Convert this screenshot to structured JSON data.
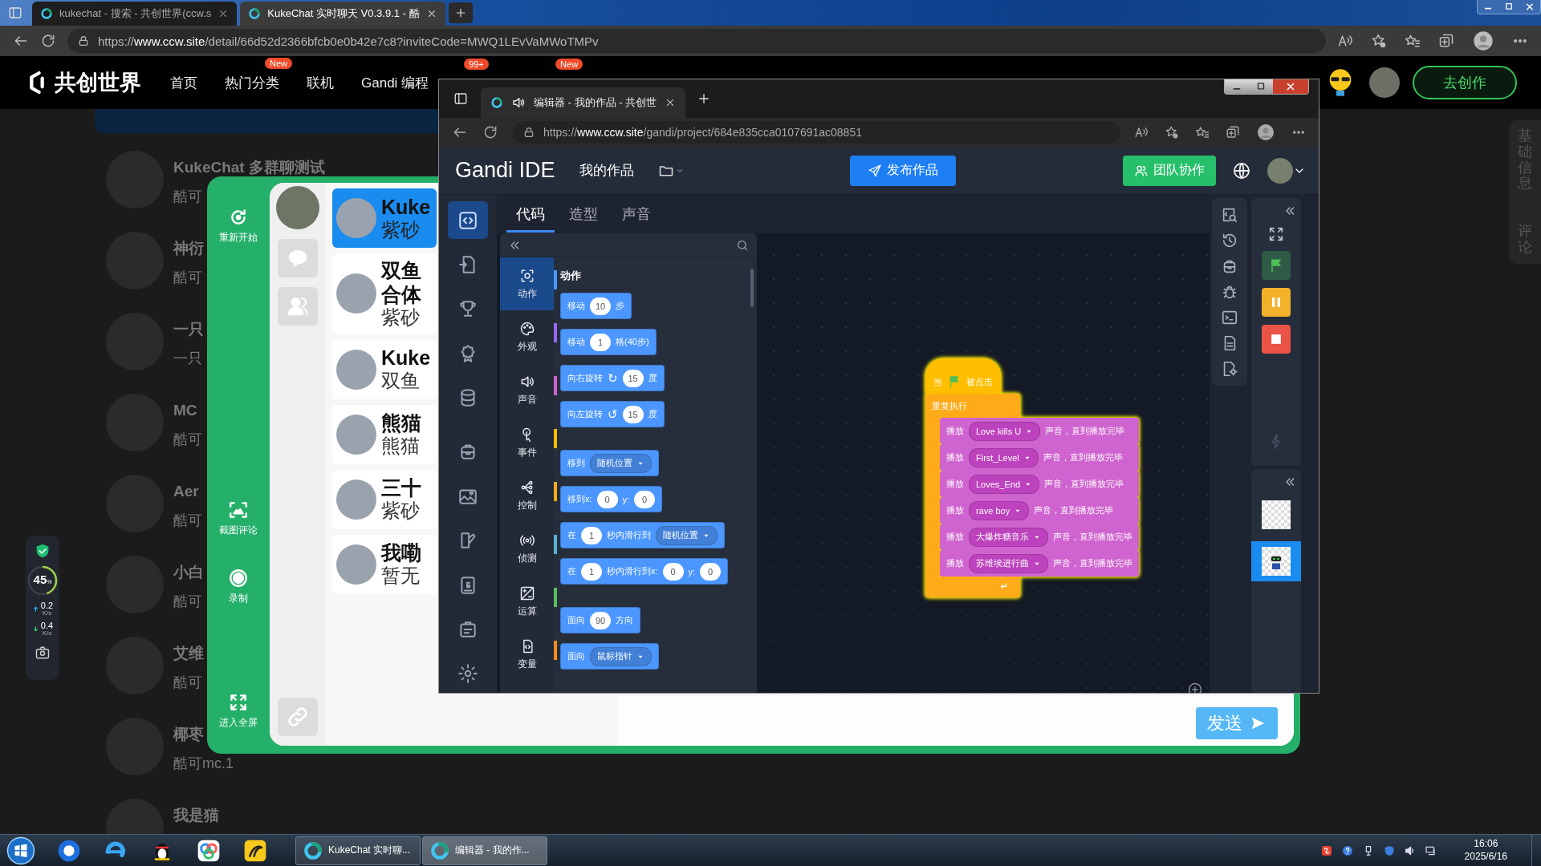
{
  "browser": {
    "tabs": [
      {
        "title": "kukechat - 搜索 - 共创世界(ccw.s",
        "selected": false
      },
      {
        "title": "KukeChat 实时聊天 V0.3.9.1 - 酷",
        "selected": true
      }
    ],
    "url": "https://**www.ccw.site**/detail/66d52d2366bfcb0e0b42e7c8?inviteCode=MWQ1LEvVaMWoTMPv"
  },
  "site": {
    "logo": "共创世界",
    "nav": [
      {
        "label": "首页"
      },
      {
        "label": "热门分类",
        "badge": "New"
      },
      {
        "label": "联机"
      },
      {
        "label": "Gandi 编程"
      },
      {
        "badge": "99+"
      },
      {
        "badge": "New"
      }
    ],
    "create": "去创作",
    "side_tabs": [
      {
        "label": "基础信息"
      },
      {
        "label": "评论"
      }
    ],
    "list": [
      {
        "name": "KukeChat 多群聊测试",
        "preview": "酷可"
      },
      {
        "name": "神衍",
        "preview": "酷可"
      },
      {
        "name": "一只",
        "preview": "一只"
      },
      {
        "name": "MC",
        "preview": "酷可"
      },
      {
        "name": "Aer",
        "preview": "酷可"
      },
      {
        "name": "小白",
        "preview": "酷可"
      },
      {
        "name": "艾维",
        "preview": "酷可"
      },
      {
        "name": "椰枣",
        "preview": "酷可mc.1"
      },
      {
        "name": "我是猫"
      }
    ]
  },
  "net": {
    "percent": "45",
    "percent_unit": "%",
    "level": 0.45,
    "up": {
      "value": "0.2",
      "unit": "K/s"
    },
    "down": {
      "value": "0.4",
      "unit": "K/s"
    }
  },
  "chat": {
    "actions": [
      {
        "kind": "restart",
        "label": "重新开始"
      },
      {
        "kind": "screenshot",
        "label": "截图评论"
      },
      {
        "kind": "record",
        "label": "录制"
      },
      {
        "kind": "fullscreen",
        "label": "进入全屏"
      }
    ],
    "conversations": [
      {
        "name": [
          "Kuke"
        ],
        "preview": "紫砂",
        "selected": true
      },
      {
        "name": [
          "双鱼",
          "合体"
        ],
        "preview": "紫砂",
        "selected": false
      },
      {
        "name": [
          "Kuke"
        ],
        "preview": "双鱼",
        "selected": false
      },
      {
        "name": [
          "熊猫"
        ],
        "preview": "熊猫",
        "selected": false
      },
      {
        "name": [
          "三十"
        ],
        "preview": "紫砂",
        "selected": false
      },
      {
        "name": [
          "我嘞"
        ],
        "preview": "暂无",
        "selected": false
      }
    ],
    "send": "发送"
  },
  "editor": {
    "tab_title": "编辑器 - 我的作品 - 共创世",
    "url": "https://**www.ccw.site**/gandi/project/684e835cca0107691ac08851",
    "brand": "**Gandi** IDE",
    "project": "我的作品",
    "publish": "发布作品",
    "team": "团队协作",
    "rail": [
      {
        "kind": "code",
        "selected": true
      },
      {
        "kind": "import",
        "selected": false
      },
      {
        "kind": "trophy",
        "selected": false
      },
      {
        "kind": "badge",
        "selected": false
      },
      {
        "kind": "database",
        "selected": false
      },
      {
        "kind": "backpack",
        "selected": false
      },
      {
        "kind": "image",
        "selected": false
      },
      {
        "kind": "book",
        "selected": false
      },
      {
        "kind": "guide",
        "selected": false
      },
      {
        "kind": "clipboard",
        "selected": false
      },
      {
        "kind": "gear",
        "selected": false
      }
    ],
    "tabs": [
      {
        "label": "代码",
        "selected": true
      },
      {
        "label": "造型",
        "selected": false
      },
      {
        "label": "声音",
        "selected": false
      }
    ],
    "categories": [
      {
        "label": "动作",
        "kind": "motion",
        "color": "#4c97ff",
        "selected": true
      },
      {
        "label": "外观",
        "kind": "looks",
        "color": "#9966ff",
        "selected": false
      },
      {
        "label": "声音",
        "kind": "sound",
        "color": "#cf63cf",
        "selected": false
      },
      {
        "label": "事件",
        "kind": "events",
        "color": "#ffbf00",
        "selected": false
      },
      {
        "label": "控制",
        "kind": "control",
        "color": "#ffab19",
        "selected": false
      },
      {
        "label": "侦测",
        "kind": "sensing",
        "color": "#5cb1d6",
        "selected": false
      },
      {
        "label": "运算",
        "kind": "operators",
        "color": "#59c059",
        "selected": false
      },
      {
        "label": "变量",
        "kind": "variables",
        "color": "#ff8c1a",
        "selected": false
      }
    ],
    "palette_title": "动作",
    "blocks": [
      {
        "parts": [
          {
            "kind": "label",
            "text": "移动"
          },
          {
            "kind": "number",
            "text": "10"
          },
          {
            "kind": "label",
            "text": "步"
          }
        ]
      },
      {
        "parts": [
          {
            "kind": "label",
            "text": "移动"
          },
          {
            "kind": "number",
            "text": "1"
          },
          {
            "kind": "label",
            "text": "格(40步)"
          }
        ]
      },
      {
        "parts": [
          {
            "kind": "label",
            "text": "向右旋转"
          },
          {
            "kind": "glyph",
            "text": "↻"
          },
          {
            "kind": "number",
            "text": "15"
          },
          {
            "kind": "label",
            "text": "度"
          }
        ]
      },
      {
        "parts": [
          {
            "kind": "label",
            "text": "向左旋转"
          },
          {
            "kind": "glyph",
            "text": "↺"
          },
          {
            "kind": "number",
            "text": "15"
          },
          {
            "kind": "label",
            "text": "度"
          }
        ]
      },
      {
        "group_start": true,
        "parts": [
          {
            "kind": "label",
            "text": "移到"
          },
          {
            "kind": "menu",
            "text": "随机位置"
          }
        ]
      },
      {
        "parts": [
          {
            "kind": "label",
            "text": "移到x:"
          },
          {
            "kind": "number",
            "text": "0"
          },
          {
            "kind": "label",
            "text": "y:"
          },
          {
            "kind": "number",
            "text": "0"
          }
        ]
      },
      {
        "parts": [
          {
            "kind": "label",
            "text": "在"
          },
          {
            "kind": "number",
            "text": "1"
          },
          {
            "kind": "label",
            "text": "秒内滑行到"
          },
          {
            "kind": "menu",
            "text": "随机位置"
          }
        ]
      },
      {
        "parts": [
          {
            "kind": "label",
            "text": "在"
          },
          {
            "kind": "number",
            "text": "1"
          },
          {
            "kind": "label",
            "text": "秒内滑行到x:"
          },
          {
            "kind": "number",
            "text": "0"
          },
          {
            "kind": "label",
            "text": "y:"
          },
          {
            "kind": "number",
            "text": "0"
          }
        ]
      },
      {
        "group_start": true,
        "parts": [
          {
            "kind": "label",
            "text": "面向"
          },
          {
            "kind": "number",
            "text": "90"
          },
          {
            "kind": "label",
            "text": "方向"
          }
        ]
      },
      {
        "parts": [
          {
            "kind": "label",
            "text": "面向"
          },
          {
            "kind": "menu",
            "text": "鼠标指针"
          }
        ]
      }
    ],
    "script": {
      "hat": [
        {
          "kind": "label",
          "text": "当"
        },
        {
          "kind": "flag"
        },
        {
          "kind": "label",
          "text": "被点击"
        }
      ],
      "loop": "重复执行",
      "body": [
        [
          {
            "kind": "label",
            "text": "播放"
          },
          {
            "kind": "menu",
            "text": "Love kills U"
          },
          {
            "kind": "label",
            "text": "声音，直到播放完毕"
          }
        ],
        [
          {
            "kind": "label",
            "text": "播放"
          },
          {
            "kind": "menu",
            "text": "First_Level"
          },
          {
            "kind": "label",
            "text": "声音，直到播放完毕"
          }
        ],
        [
          {
            "kind": "label",
            "text": "播放"
          },
          {
            "kind": "menu",
            "text": "Loves_End"
          },
          {
            "kind": "label",
            "text": "声音，直到播放完毕"
          }
        ],
        [
          {
            "kind": "label",
            "text": "播放"
          },
          {
            "kind": "menu",
            "text": "rave boy"
          },
          {
            "kind": "label",
            "text": "声音，直到播放完毕"
          }
        ],
        [
          {
            "kind": "label",
            "text": "播放"
          },
          {
            "kind": "menu",
            "text": "大爆炸糖音乐"
          },
          {
            "kind": "label",
            "text": "声音，直到播放完毕"
          }
        ],
        [
          {
            "kind": "label",
            "text": "播放"
          },
          {
            "kind": "menu",
            "text": "苏维埃进行曲"
          },
          {
            "kind": "label",
            "text": "声音，直到播放完毕"
          }
        ]
      ]
    },
    "sprites": [
      {
        "kind": "blank",
        "selected": false
      },
      {
        "kind": "robot",
        "selected": true
      }
    ]
  },
  "taskbar": {
    "tasks": [
      {
        "label": "KukeChat 实时聊...",
        "selected": false
      },
      {
        "label": "编辑器 - 我的作...",
        "selected": true
      }
    ],
    "time": "16:06",
    "date": "2025/6/16"
  }
}
